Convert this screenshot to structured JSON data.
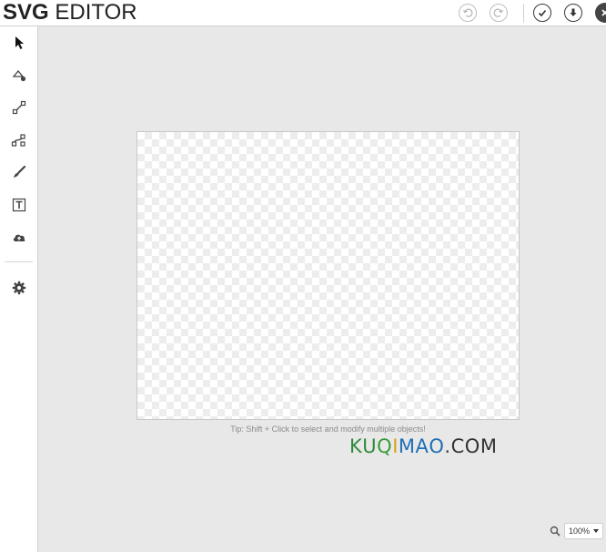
{
  "header": {
    "title_bold": "SVG",
    "title_rest": "EDITOR",
    "buttons": {
      "undo_icon": "undo-icon",
      "redo_icon": "redo-icon",
      "confirm_icon": "check-icon",
      "download_icon": "download-icon",
      "close_icon": "close-icon"
    }
  },
  "sidebar": {
    "tools": [
      {
        "name": "select",
        "icon": "pointer-arrow-icon"
      },
      {
        "name": "fill",
        "icon": "paint-bucket-icon"
      },
      {
        "name": "line",
        "icon": "line-icon"
      },
      {
        "name": "path",
        "icon": "bezier-path-icon"
      },
      {
        "name": "brush",
        "icon": "brush-icon"
      },
      {
        "name": "text",
        "icon": "text-icon"
      },
      {
        "name": "upload",
        "icon": "cloud-upload-icon"
      },
      {
        "name": "settings",
        "icon": "gear-icon"
      }
    ]
  },
  "canvas": {
    "tip": "Tip: Shift + Click to select and modify multiple objects!"
  },
  "watermark": {
    "letters": [
      "K",
      "U",
      "Q",
      "I",
      "M",
      "A",
      "O",
      ".",
      "C",
      "O",
      "M"
    ],
    "colors": [
      "#2e8b3a",
      "#2e8b3a",
      "#3a9a3a",
      "#d9a21b",
      "#1f6fb5",
      "#1f6fb5",
      "#1f6fb5",
      "#444444",
      "#333333",
      "#333333",
      "#333333"
    ]
  },
  "zoom": {
    "icon": "search-icon",
    "value": "100%"
  }
}
